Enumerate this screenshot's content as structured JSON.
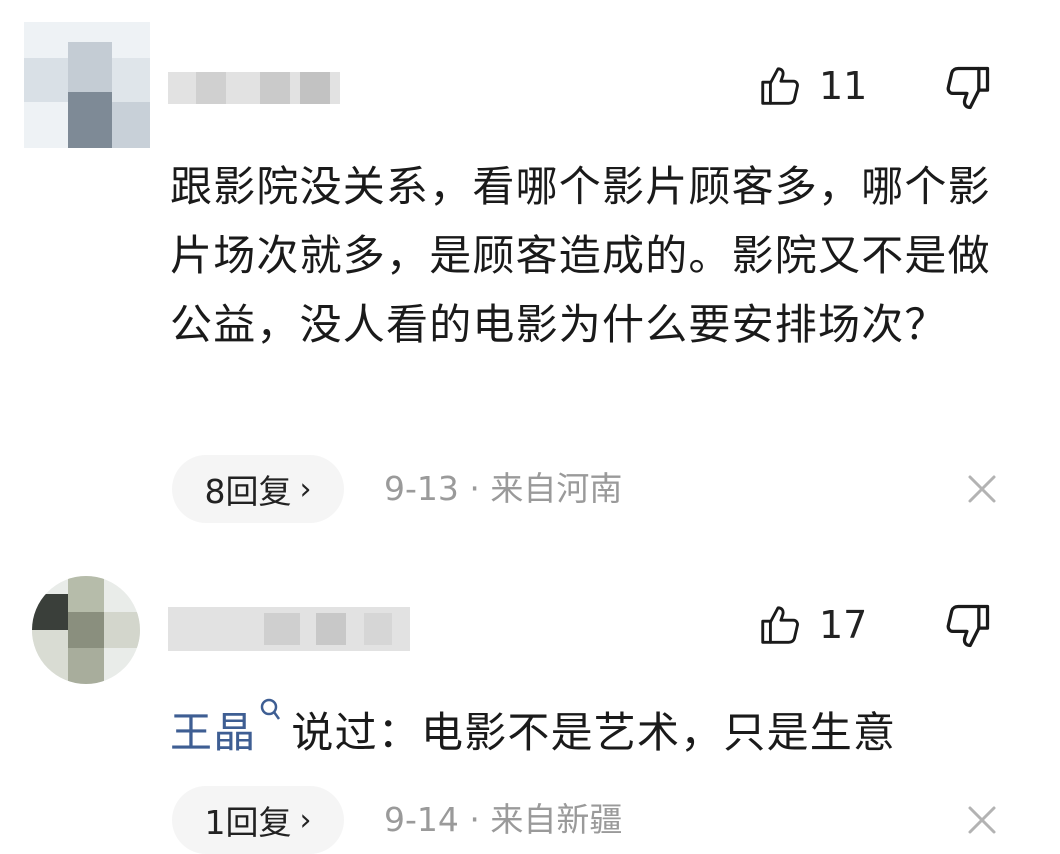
{
  "comments": [
    {
      "like_count": "11",
      "text": "跟影院没关系，看哪个影片顾客多，哪个影片场次就多，是顾客造成的。影院又不是做公益，没人看的电影为什么要安排场次？",
      "replies_label": "8回复",
      "meta": "9-13 · 来自河南"
    },
    {
      "like_count": "17",
      "mention": "王晶",
      "text": "说过：电影不是艺术，只是生意",
      "replies_label": "1回复",
      "meta": "9-14 · 来自新疆"
    }
  ],
  "icons": {
    "like": "thumb-up-icon",
    "dislike": "thumb-down-icon",
    "more": "chevron-right-icon",
    "close": "close-icon",
    "mention": "search-icon"
  },
  "colors": {
    "mention": "#3e5e93",
    "meta": "#9a9a9a",
    "pill_bg": "#f5f5f5"
  }
}
